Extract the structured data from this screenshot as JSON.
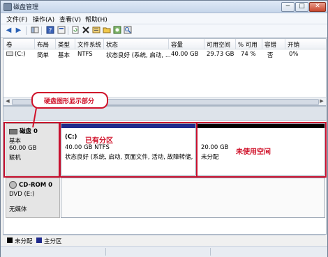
{
  "window": {
    "title": "磁盘管理",
    "minimize": "─",
    "maximize": "□",
    "close": "✕"
  },
  "menu": [
    "文件(F)",
    "操作(A)",
    "查看(V)",
    "帮助(H)"
  ],
  "toolbar": {
    "back": "◀",
    "forward": "▶",
    "icons": [
      "console-tree-icon",
      "help-icon",
      "console-icon",
      "refresh-icon",
      "delete-icon",
      "properties-icon",
      "open-folder-icon",
      "explore-icon",
      "zoom-icon"
    ]
  },
  "volume_table": {
    "headers": [
      "卷",
      "布局",
      "类型",
      "文件系统",
      "状态",
      "容量",
      "可用空间",
      "% 可用",
      "容错",
      "开销"
    ],
    "rows": [
      [
        "(C:)",
        "简单",
        "基本",
        "NTFS",
        "状态良好 (系统, 启动, ...",
        "40.00 GB",
        "29.73 GB",
        "74 %",
        "否",
        "0%"
      ]
    ]
  },
  "annotation": {
    "callout": "硬盘图形显示部分",
    "existing_partition": "已有分区",
    "unused_space": "未使用空间"
  },
  "disk0": {
    "name": "磁盘 0",
    "type": "基本",
    "size": "60.00 GB",
    "status": "联机",
    "partition_c": {
      "label": "(C:)",
      "size_fs": "40.00 GB NTFS",
      "status": "状态良好 (系统, 启动, 页面文件, 活动, 故障转储, 主分"
    },
    "unallocated": {
      "size": "20.00 GB",
      "status": "未分配"
    }
  },
  "cdrom0": {
    "name": "CD-ROM 0",
    "drive": "DVD (E:)",
    "status": "无媒体"
  },
  "legend": [
    {
      "label": "未分配",
      "color": "#000000"
    },
    {
      "label": "主分区",
      "color": "#1f2a8c"
    }
  ],
  "colors": {
    "primary_partition": "#1f2a8c",
    "unallocated": "#000000",
    "annotation_red": "#d0122a"
  }
}
